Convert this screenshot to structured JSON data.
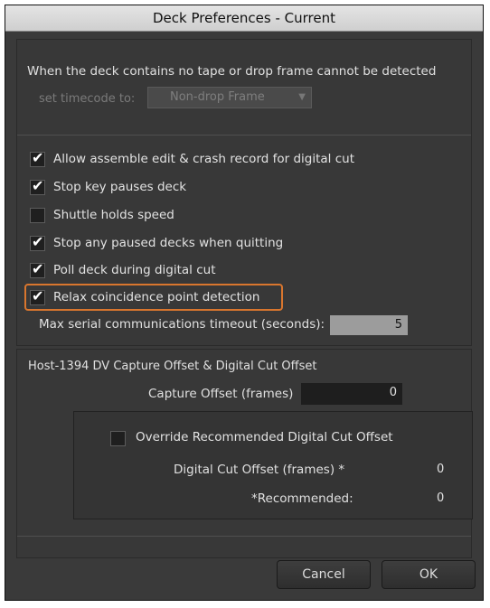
{
  "window": {
    "title": "Deck Preferences - Current"
  },
  "no_tape": {
    "description": "When the deck contains no tape or drop frame cannot be detected",
    "timecode_label": "set timecode to:",
    "timecode_value": "Non-drop Frame"
  },
  "options": [
    {
      "label": "Allow assemble edit & crash record for digital cut",
      "checked": true
    },
    {
      "label": "Stop key pauses deck",
      "checked": true
    },
    {
      "label": "Shuttle holds speed",
      "checked": false
    },
    {
      "label": "Stop any paused decks when quitting",
      "checked": true
    },
    {
      "label": "Poll deck during digital cut",
      "checked": true
    },
    {
      "label": "Relax coincidence point detection",
      "checked": true
    }
  ],
  "timeout": {
    "label": "Max serial communications timeout (seconds):",
    "value": "5"
  },
  "offsets": {
    "heading": "Host-1394 DV Capture Offset & Digital Cut Offset",
    "capture_label": "Capture Offset (frames)",
    "capture_value": "0",
    "override_label": "Override Recommended Digital Cut Offset",
    "override_checked": false,
    "digital_cut_label": "Digital Cut Offset (frames) *",
    "digital_cut_value": "0",
    "recommended_label": "*Recommended:",
    "recommended_value": "0"
  },
  "buttons": {
    "cancel": "Cancel",
    "ok": "OK"
  },
  "colors": {
    "highlight": "#d9762e",
    "background": "#3a3a3a"
  },
  "icons": {
    "checkmark": "check-icon",
    "dropdown": "chevron-down-icon"
  }
}
